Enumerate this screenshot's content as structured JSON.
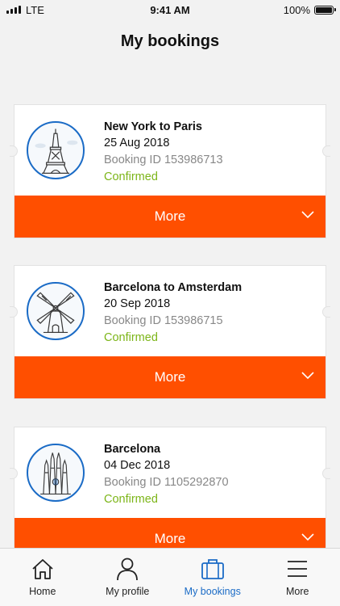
{
  "status_bar": {
    "carrier": "LTE",
    "time": "9:41 AM",
    "battery": "100%"
  },
  "header": {
    "title": "My bookings"
  },
  "bookings": [
    {
      "title": "New York to Paris",
      "date": "25 Aug 2018",
      "booking_id": "Booking ID 153986713",
      "status": "Confirmed",
      "more_label": "More",
      "icon": "eiffel-tower-icon"
    },
    {
      "title": "Barcelona to Amsterdam",
      "date": "20 Sep 2018",
      "booking_id": "Booking ID 153986715",
      "status": "Confirmed",
      "more_label": "More",
      "icon": "windmill-icon"
    },
    {
      "title": "Barcelona",
      "date": "04 Dec 2018",
      "booking_id": "Booking ID 1105292870",
      "status": "Confirmed",
      "more_label": "More",
      "icon": "sagrada-familia-icon"
    }
  ],
  "tabs": [
    {
      "label": "Home",
      "icon": "home-icon",
      "active": false
    },
    {
      "label": "My profile",
      "icon": "profile-icon",
      "active": false
    },
    {
      "label": "My bookings",
      "icon": "suitcase-icon",
      "active": true
    },
    {
      "label": "More",
      "icon": "menu-icon",
      "active": false
    }
  ],
  "colors": {
    "accent": "#ff4f00",
    "active_tab": "#1a6bc6",
    "confirmed": "#7cb518",
    "muted": "#888888"
  }
}
